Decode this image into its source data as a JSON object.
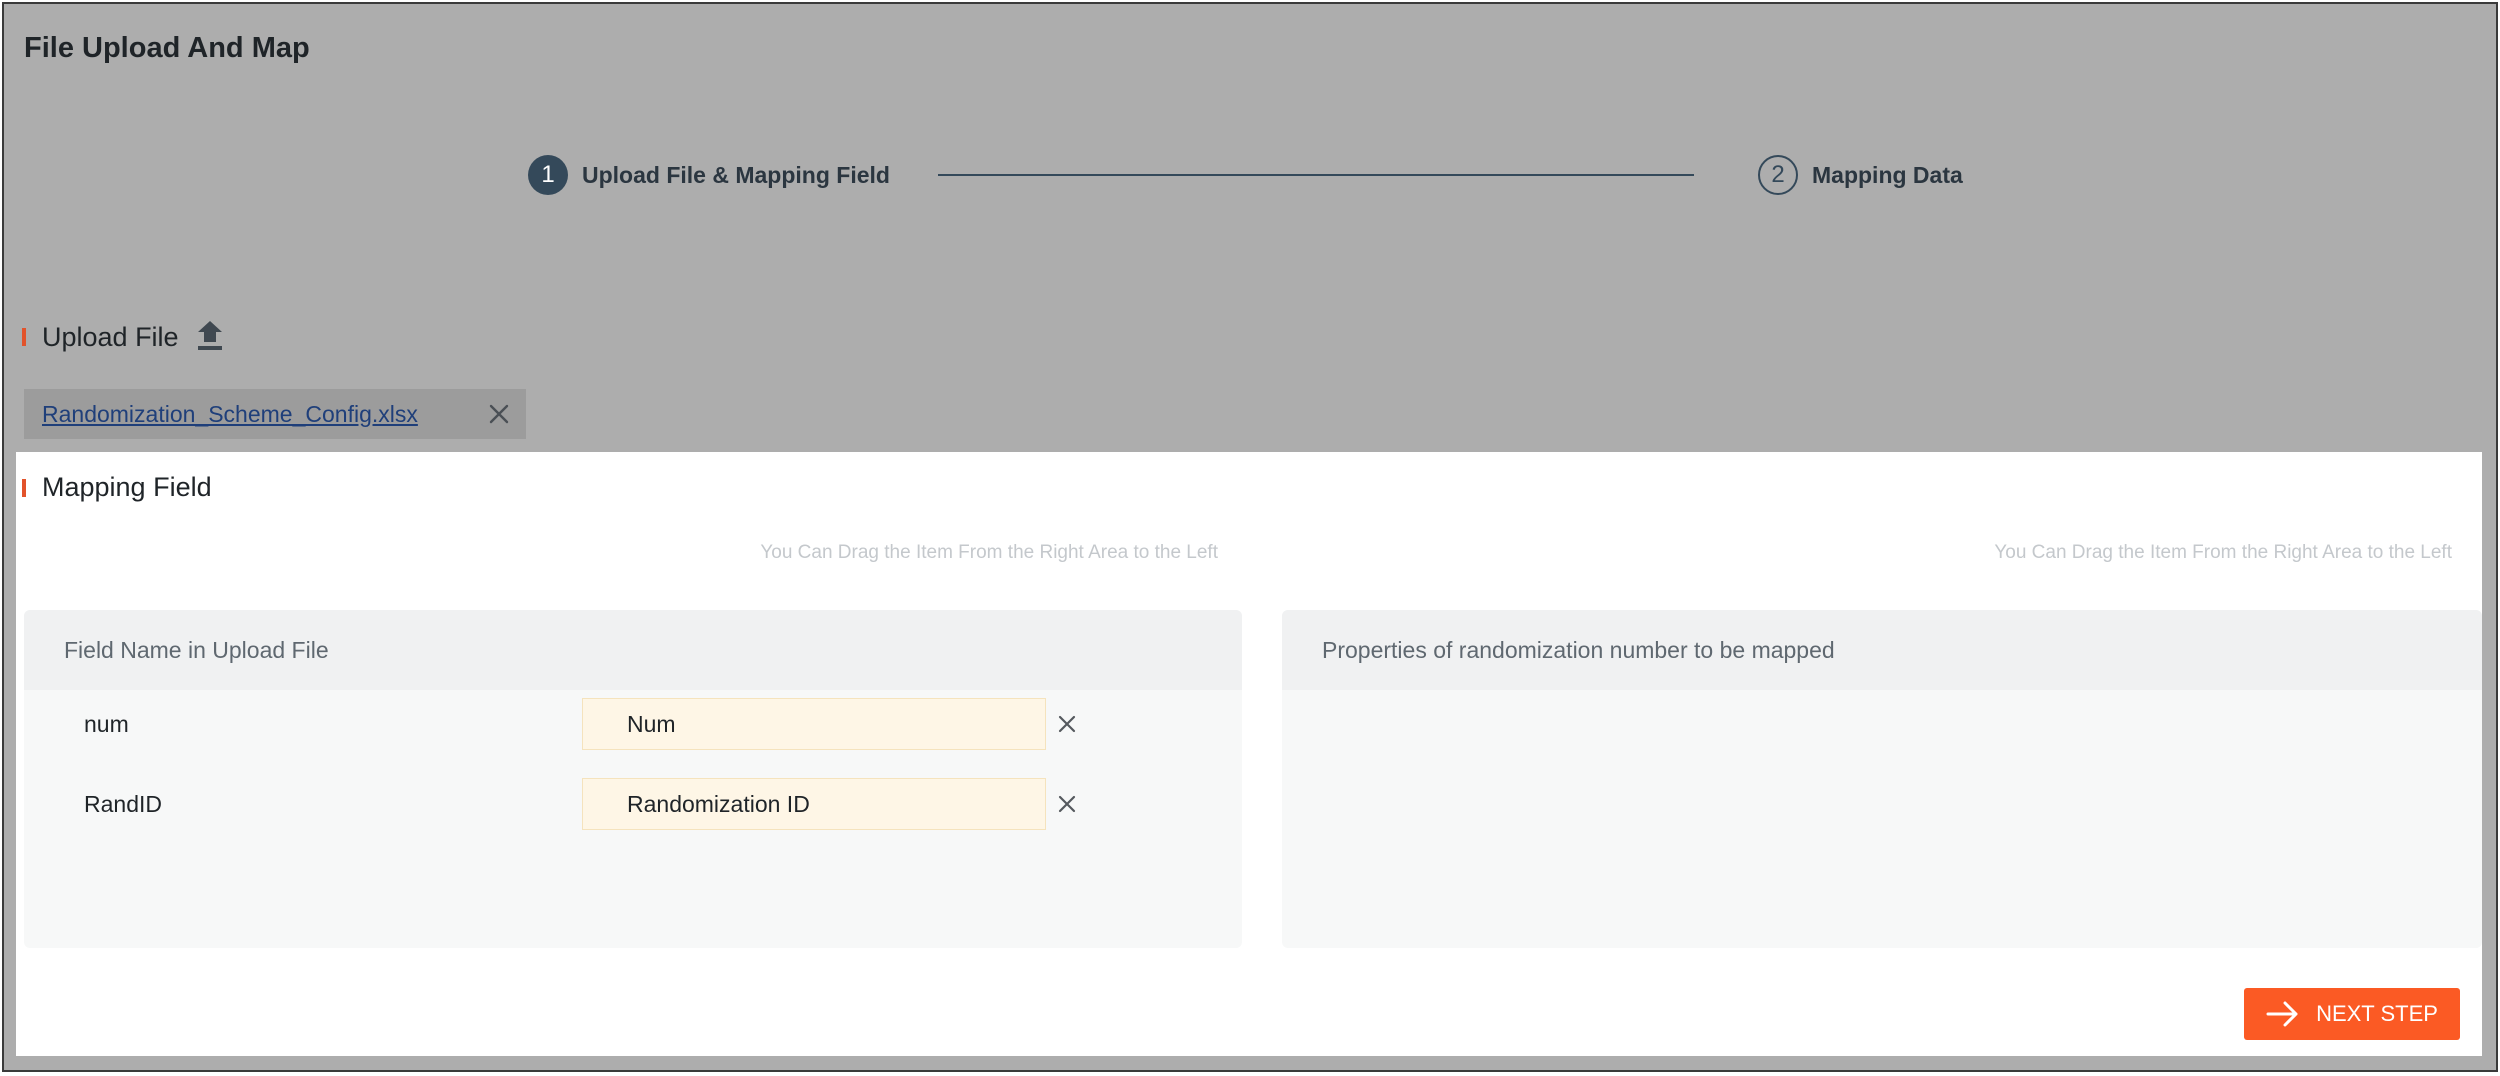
{
  "window": {
    "title": "File Upload And Map"
  },
  "stepper": {
    "steps": [
      {
        "number": "1",
        "label": "Upload File & Mapping Field",
        "state": "active"
      },
      {
        "number": "2",
        "label": "Mapping Data",
        "state": "pending"
      }
    ]
  },
  "upload": {
    "title": "Upload File",
    "icon": "upload-icon",
    "file_name": "Randomization_Scheme_Config.xlsx",
    "remove_icon": "close-icon"
  },
  "mapping": {
    "title": "Mapping Field",
    "hint_left": "You Can Drag the Item From the Right Area to the Left",
    "hint_right": "You Can Drag the Item From the Right Area to the Left",
    "left_panel_header": "Field Name in Upload File",
    "right_panel_header": "Properties of randomization number to be mapped",
    "rows": [
      {
        "field": "num",
        "mapped_to": "Num"
      },
      {
        "field": "RandID",
        "mapped_to": "Randomization ID"
      }
    ]
  },
  "actions": {
    "next_label": "NEXT STEP",
    "next_icon": "arrow-right-icon"
  },
  "colors": {
    "accent": "#fb5a24",
    "section_bar": "#e2532b",
    "step_active": "#34495a",
    "mapped_bg": "#fef6e6",
    "overlay": "#adadad"
  }
}
